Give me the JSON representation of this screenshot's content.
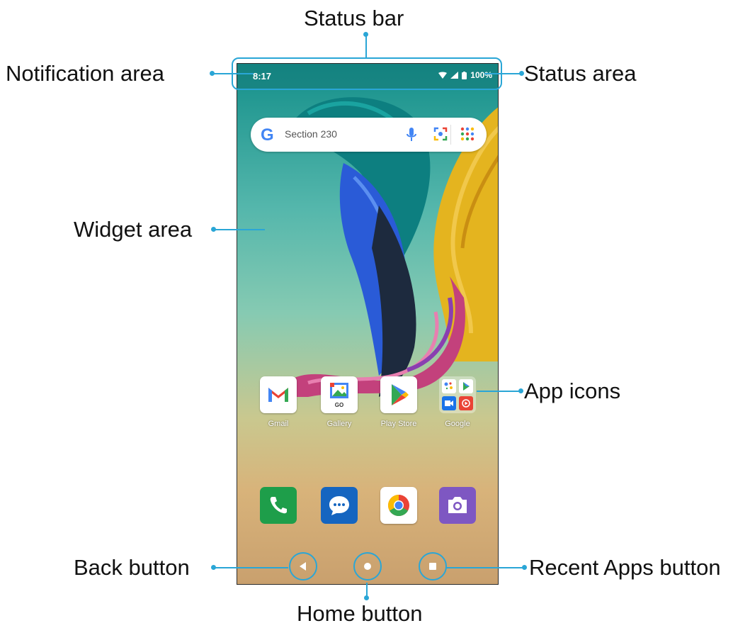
{
  "callouts": {
    "status_bar": "Status bar",
    "notification_area": "Notification area",
    "status_area": "Status area",
    "widget_area": "Widget area",
    "app_icons": "App icons",
    "back_button": "Back button",
    "home_button": "Home button",
    "recent_apps_button": "Recent Apps button"
  },
  "phone": {
    "status_bar": {
      "time": "8:17",
      "battery": "100%"
    },
    "search": {
      "placeholder": "Section 230",
      "logo": "G"
    },
    "apps": [
      {
        "name": "Gmail",
        "icon": "gmail-icon"
      },
      {
        "name": "Gallery",
        "icon": "gallery-icon",
        "badge": "GO"
      },
      {
        "name": "Play Store",
        "icon": "play-store-icon"
      },
      {
        "name": "Google",
        "icon": "google-folder-icon"
      }
    ],
    "dock": [
      {
        "icon": "phone-icon"
      },
      {
        "icon": "messages-icon"
      },
      {
        "icon": "chrome-icon"
      },
      {
        "icon": "camera-icon"
      }
    ],
    "nav": [
      "back-icon",
      "home-icon",
      "recent-apps-icon"
    ]
  },
  "colors": {
    "callout": "#2aa6d6",
    "accent": "#148f8a"
  }
}
